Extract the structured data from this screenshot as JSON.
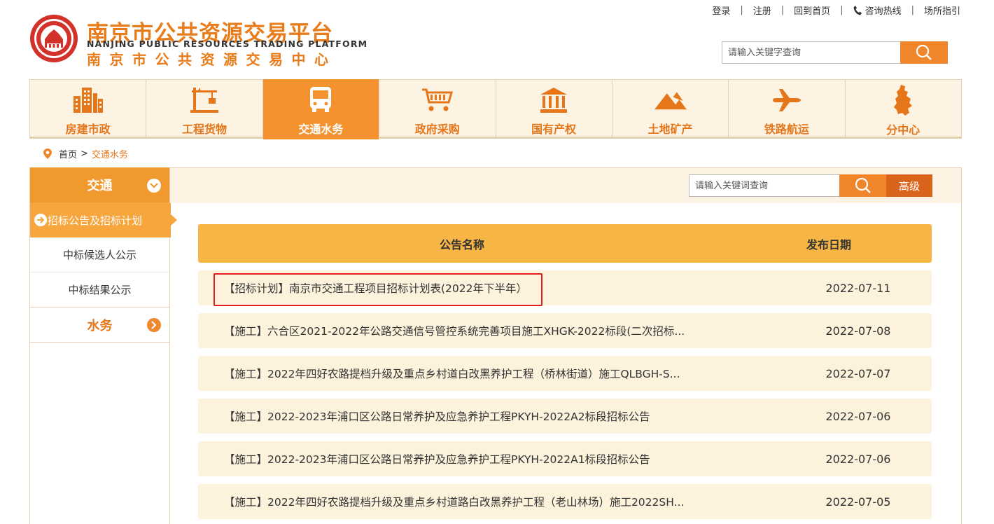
{
  "header": {
    "title_cn": "南京市公共资源交易平台",
    "title_en": "NANJING PUBLIC RESOURCES TRADING PLATFORM",
    "title_center": "南京市公共资源交易中心",
    "links": {
      "login": "登录",
      "register": "注册",
      "home": "回到首页",
      "hotline": "咨询热线",
      "guide": "场所指引",
      "sep": "|"
    },
    "search_placeholder": "请输入关键字查询"
  },
  "nav": {
    "items": [
      {
        "label": "房建市政",
        "icon": "buildings-icon"
      },
      {
        "label": "工程货物",
        "icon": "crane-icon"
      },
      {
        "label": "交通水务",
        "icon": "bus-icon"
      },
      {
        "label": "政府采购",
        "icon": "cart-icon"
      },
      {
        "label": "国有产权",
        "icon": "bank-icon"
      },
      {
        "label": "土地矿产",
        "icon": "mountain-icon"
      },
      {
        "label": "铁路航运",
        "icon": "plane-icon"
      },
      {
        "label": "分中心",
        "icon": "map-icon"
      }
    ],
    "active_index": 2
  },
  "breadcrumb": {
    "home": "首页",
    "sep": ">",
    "current": "交通水务"
  },
  "sidebar": {
    "group1": "交通",
    "active_item": "招标公告及招标计划",
    "items": [
      "中标候选人公示",
      "中标结果公示"
    ],
    "group2": "水务"
  },
  "main": {
    "search_placeholder": "请输入关键词查询",
    "advanced": "高级",
    "table": {
      "col_name": "公告名称",
      "col_date": "发布日期",
      "rows": [
        {
          "title": "【招标计划】南京市交通工程项目招标计划表(2022年下半年）",
          "date": "2022-07-11"
        },
        {
          "title": "【施工】六合区2021-2022年公路交通信号管控系统完善项目施工XHGK-2022标段(二次招标...",
          "date": "2022-07-08"
        },
        {
          "title": "【施工】2022年四好农路提档升级及重点乡村道白改黑养护工程（桥林街道）施工QLBGH-S...",
          "date": "2022-07-07"
        },
        {
          "title": "【施工】2022-2023年浦口区公路日常养护及应急养护工程PKYH-2022A2标段招标公告",
          "date": "2022-07-06"
        },
        {
          "title": "【施工】2022-2023年浦口区公路日常养护及应急养护工程PKYH-2022A1标段招标公告",
          "date": "2022-07-06"
        },
        {
          "title": "【施工】2022年四好农路提档升级及重点乡村道路白改黑养护工程（老山林场）施工2022SH...",
          "date": "2022-07-05"
        }
      ]
    }
  },
  "colors": {
    "accent": "#f3922e",
    "nav_bg": "#fdf3e3",
    "highlight_box": "#e02020"
  }
}
